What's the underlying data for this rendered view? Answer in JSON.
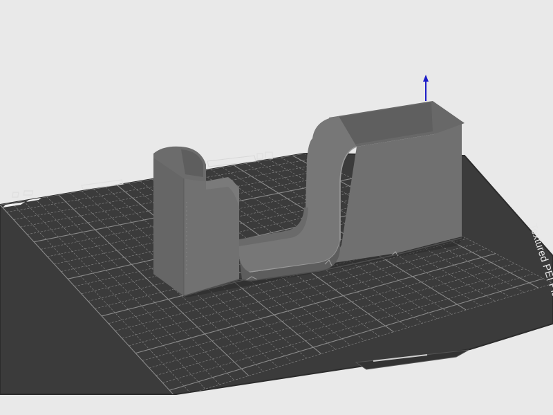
{
  "viewport": {
    "background": "#e9e9e9"
  },
  "build_plate": {
    "label": "Textured PEI Plate",
    "color": "#3b3b3b",
    "grid_color": "#8a8a8a",
    "edge_color": "#2c2c2c"
  },
  "model": {
    "color": "#707070",
    "shade_color": "#5c5c5c",
    "highlight_color": "#9a9a9a"
  },
  "gizmo": {
    "z_axis_color": "#1c1cc8"
  }
}
